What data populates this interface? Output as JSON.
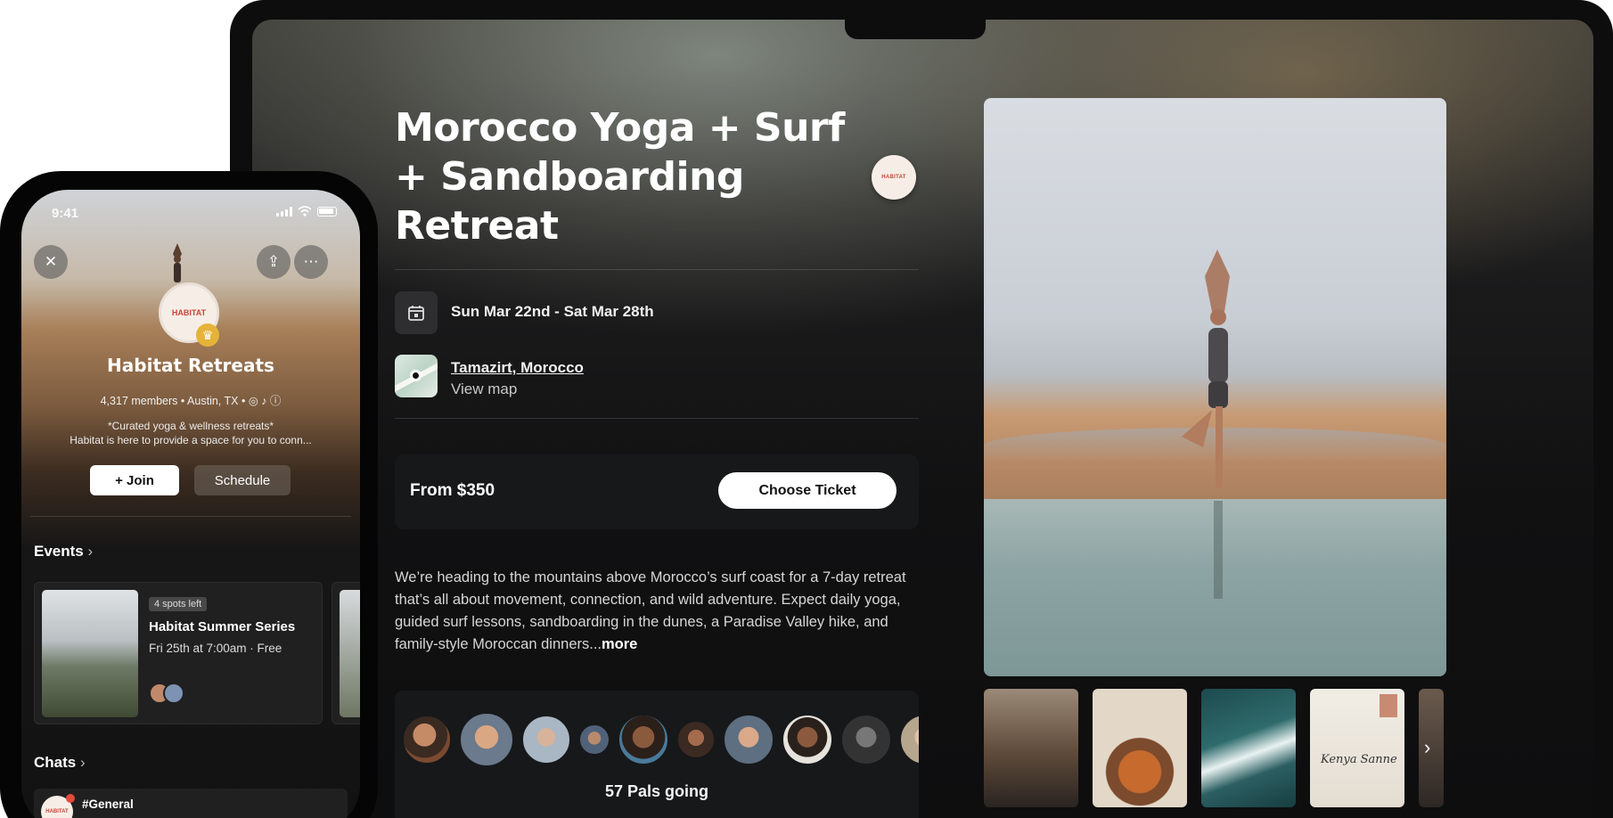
{
  "event": {
    "title": "Morocco Yoga + Surf + Sandboarding Retreat",
    "host_badge": "HABITAT",
    "dates": "Sun Mar 22nd - Sat Mar 28th",
    "location": "Tamazirt, Morocco",
    "view_map": "View map",
    "price": "From $350",
    "choose_ticket": "Choose Ticket",
    "description": "We’re heading to the mountains above Morocco’s surf coast for a 7-day retreat that’s all about movement, connection, and wild adventure. Expect daily yoga, guided surf lessons, sandboarding in the dunes, a Paradise Valley hike, and family-style Moroccan dinners...",
    "more": "more",
    "pals_going": "57 Pals going",
    "thumb_next_icon": "chevron-right-icon"
  },
  "phone": {
    "time": "9:41",
    "host_initials": "HABITAT",
    "group_name": "Habitat Retreats",
    "meta": "4,317 members  •  Austin, TX  •  ◎  ♪  ⓘ",
    "bio_line1": "*Curated yoga & wellness retreats*",
    "bio_line2": "Habitat is here to provide a space for you to conn...",
    "join": "+ Join",
    "schedule": "Schedule",
    "events_heading": "Events",
    "event_card": {
      "spots": "4 spots left",
      "title": "Habitat Summer Series",
      "time": "Fri 25th at 7:00am · Free"
    },
    "chats_heading": "Chats",
    "chat_name": "#General"
  }
}
